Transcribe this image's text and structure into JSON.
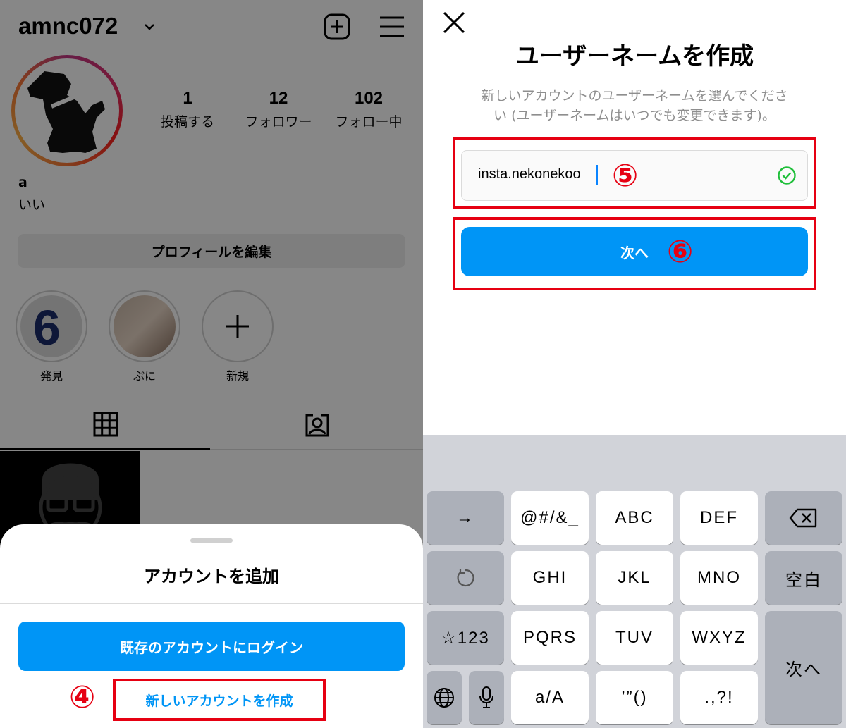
{
  "profile": {
    "username": "amnc072",
    "stats": [
      {
        "num": "1",
        "label": "投稿する"
      },
      {
        "num": "12",
        "label": "フォロワー"
      },
      {
        "num": "102",
        "label": "フォロー中"
      }
    ],
    "bio_name": "a",
    "bio_text": "いい",
    "edit_profile_label": "プロフィールを編集",
    "highlights": [
      {
        "label": "発見"
      },
      {
        "label": "ぷに"
      },
      {
        "label": "新規"
      }
    ]
  },
  "sheet": {
    "title": "アカウントを追加",
    "login_label": "既存のアカウントにログイン",
    "create_label": "新しいアカウントを作成"
  },
  "steps": {
    "four": "④",
    "five": "⑤",
    "six": "⑥"
  },
  "create_username": {
    "title": "ユーザーネームを作成",
    "desc_line1": "新しいアカウントのユーザーネームを選んでくださ",
    "desc_line2": "い (ユーザーネームはいつでも変更できます)。",
    "input_value": "insta.nekonekoo",
    "next_label": "次へ"
  },
  "keyboard": {
    "row1": [
      "→",
      "@#/&_",
      "ABC",
      "DEF",
      "⌫"
    ],
    "row2": [
      "↺",
      "GHI",
      "JKL",
      "MNO",
      "空白"
    ],
    "row3": [
      "☆123",
      "PQRS",
      "TUV",
      "WXYZ",
      "次へ"
    ],
    "row4": [
      "🌐",
      "🎤",
      "a/A",
      "’”()",
      ".,?!"
    ]
  },
  "colors": {
    "accent": "#0095f6",
    "highlight_red": "#e60012"
  }
}
